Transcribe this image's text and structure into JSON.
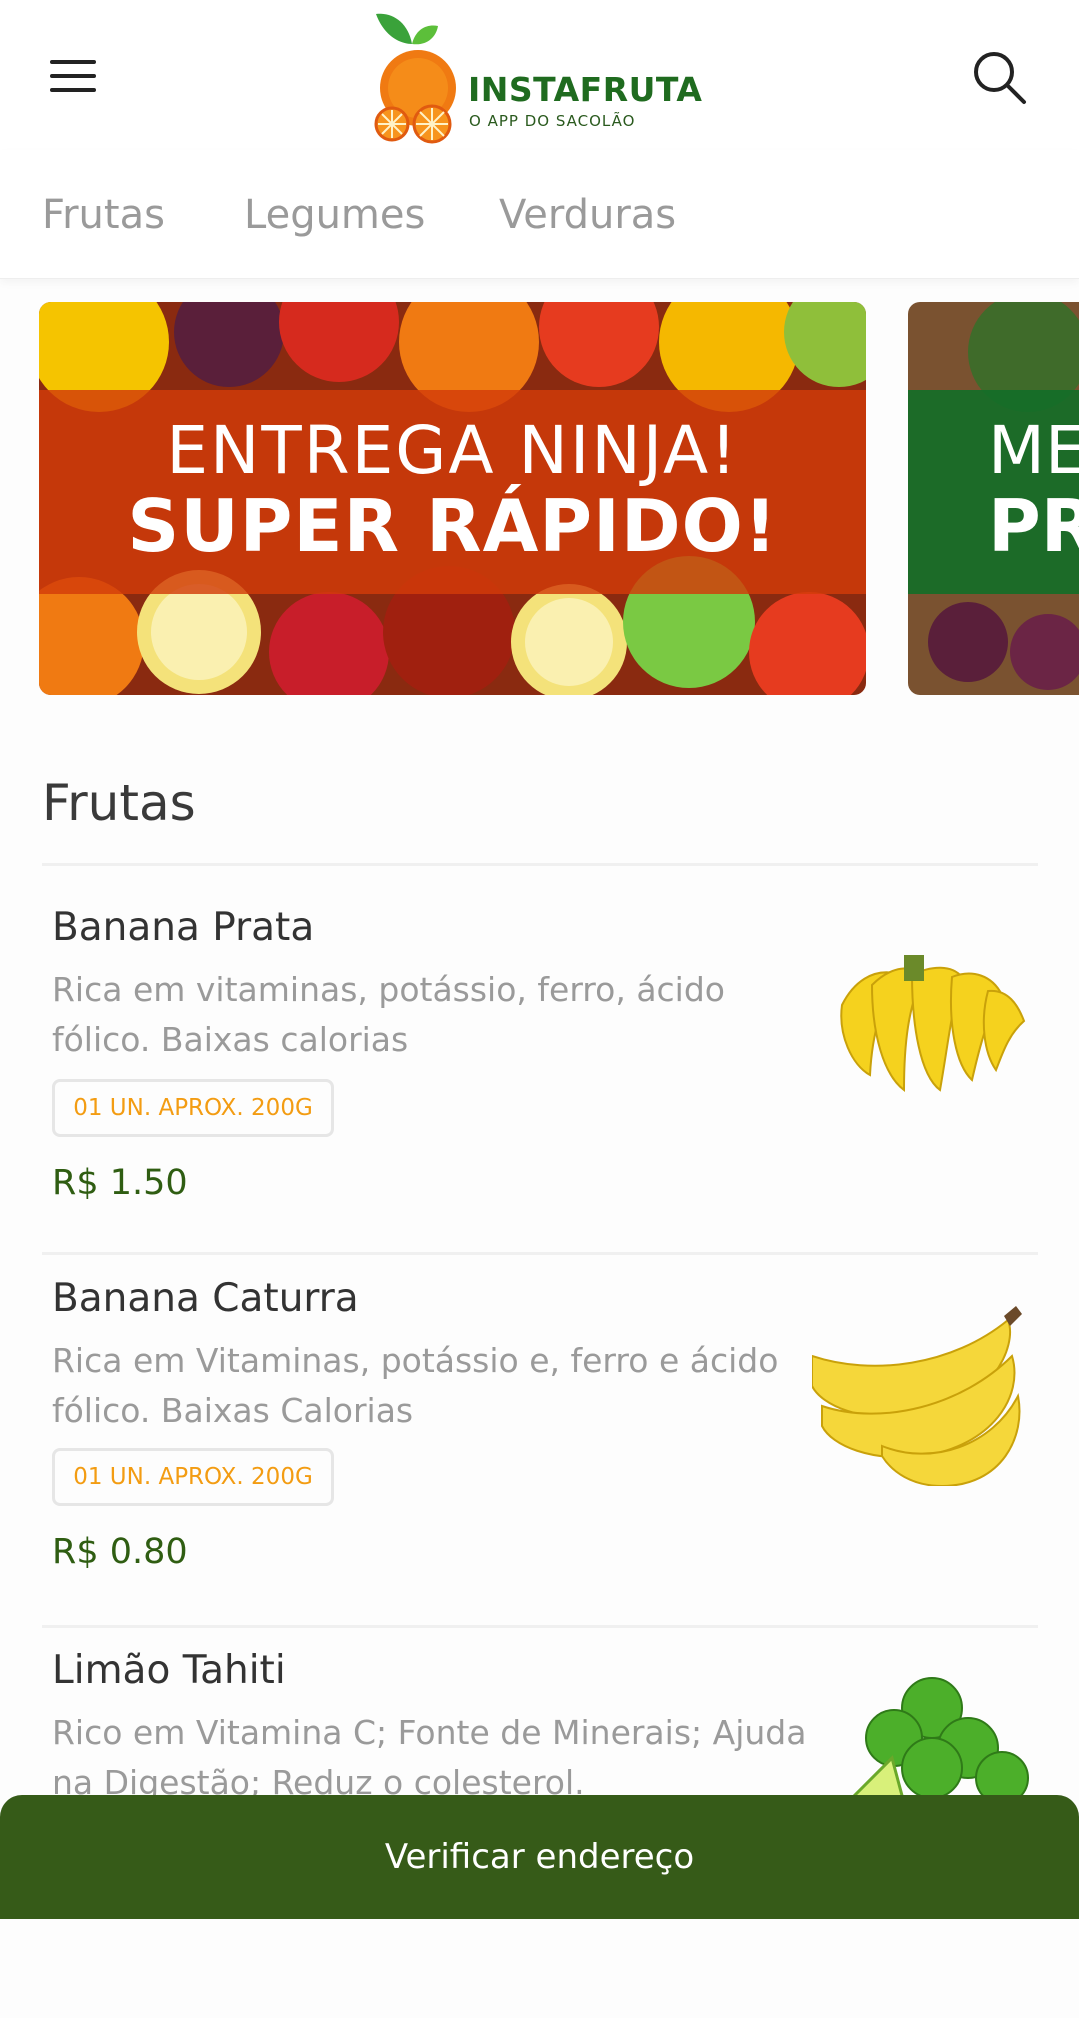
{
  "app": {
    "logo_title": "INSTAFRUTA",
    "logo_subtitle": "O APP DO SACOLÃO",
    "brand_color": "#1f6b1f",
    "accent_color": "#365b18"
  },
  "header": {
    "menu_icon": "hamburger-icon",
    "search_icon": "search-icon"
  },
  "tabs": [
    {
      "label": "Frutas"
    },
    {
      "label": "Legumes"
    },
    {
      "label": "Verduras"
    }
  ],
  "banners": [
    {
      "line1": "ENTREGA NINJA!",
      "line2": "SUPER RÁPIDO!"
    },
    {
      "line1": "ME",
      "line2": "PR"
    }
  ],
  "section": {
    "title": "Frutas"
  },
  "products": [
    {
      "name": "Banana Prata",
      "description": "Rica em vitaminas, potássio, ferro, ácido fólico. Baixas calorias",
      "unit": "01 UN. APROX. 200G",
      "price": "R$ 1.50",
      "image": "banana-prata-image"
    },
    {
      "name": "Banana Caturra",
      "description": "Rica em Vitaminas, potássio e, ferro e ácido fólico. Baixas Calorias",
      "unit": "01 UN. APROX. 200G",
      "price": "R$ 0.80",
      "image": "banana-caturra-image"
    },
    {
      "name": "Limão Tahiti",
      "description": "Rico em Vitamina C; Fonte de Minerais; Ajuda na Digestão; Reduz o colesterol.",
      "unit": "",
      "price": "",
      "image": "limao-tahiti-image"
    }
  ],
  "bottom_bar": {
    "label": "Verificar endereço"
  }
}
